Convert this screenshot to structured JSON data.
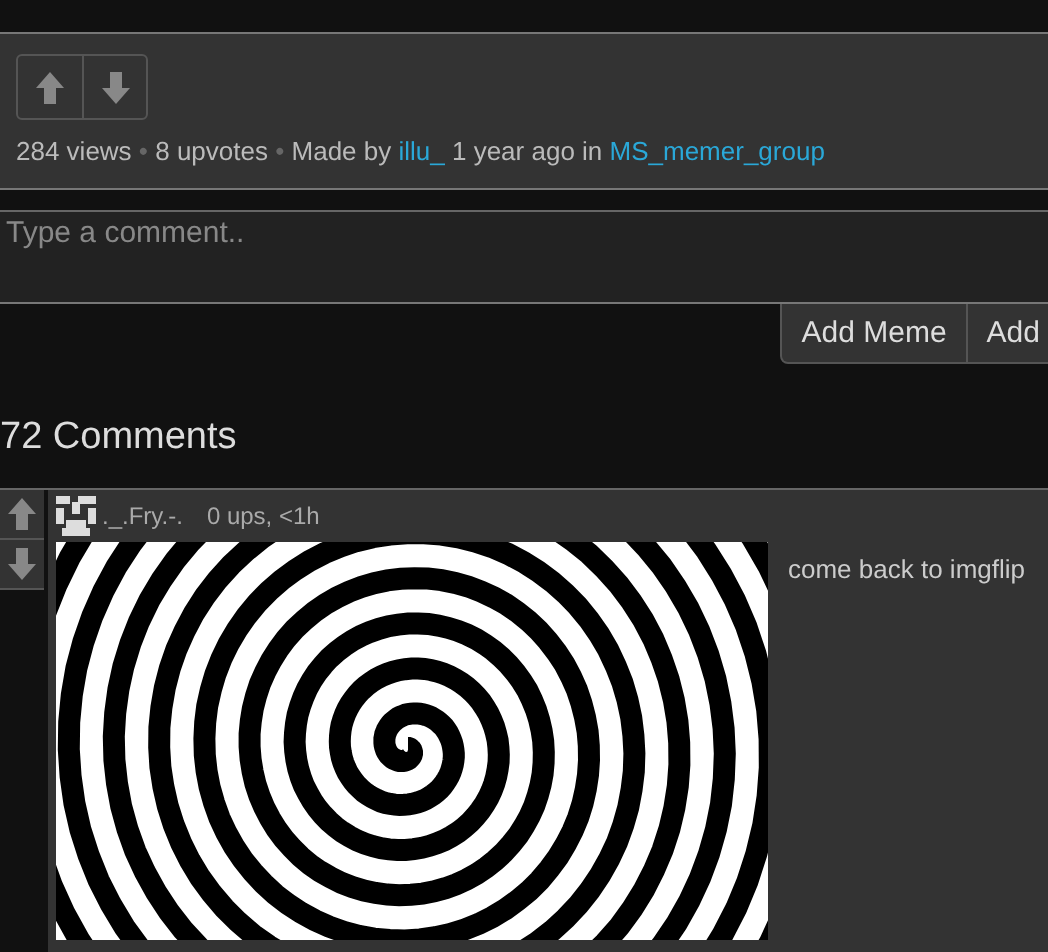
{
  "post": {
    "views": "284 views",
    "separator": "•",
    "upvotes": "8 upvotes",
    "made_by": "Made by",
    "author": "illu_",
    "time": "1 year ago in",
    "group": "MS_memer_group"
  },
  "comment_box": {
    "placeholder": "Type a comment.."
  },
  "buttons": [
    "Add Meme",
    "Add"
  ],
  "comments_heading": "72 Comments",
  "comments": [
    {
      "username": "._.Fry.-.",
      "meta": "0 ups, <1h",
      "text": "come back to imgflip"
    }
  ]
}
